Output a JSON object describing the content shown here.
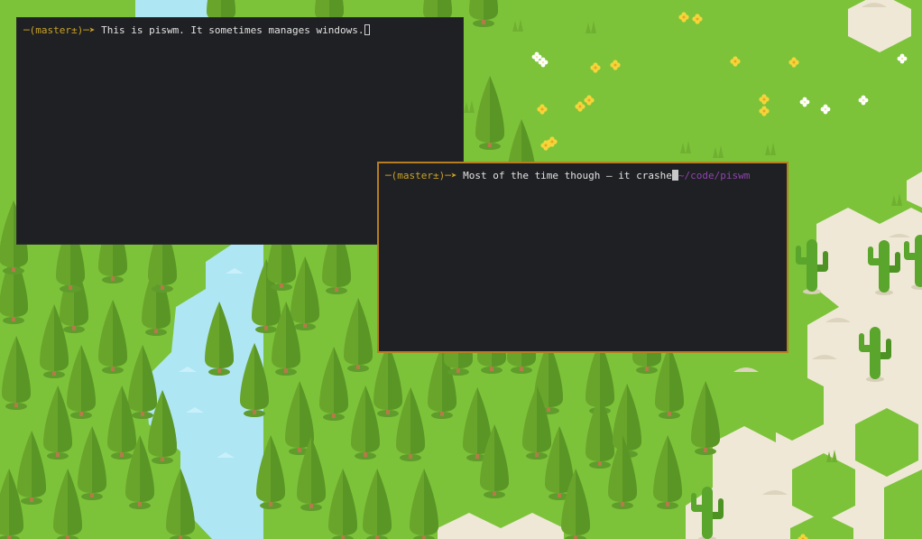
{
  "terminals": [
    {
      "prompt": "─(master±)─➤ ",
      "command": "This is piswm. It sometimes manages windows.",
      "focused": false
    },
    {
      "prompt": "─(master±)─➤ ",
      "command": "Most of the time though – it crashe",
      "right_prompt": "~/code/piswm",
      "focused": true,
      "border_color": "#b77d22"
    }
  ],
  "colors": {
    "grass": "#7cc33a",
    "sand": "#efe8d6",
    "water": "#aee6f4",
    "terminal_bg": "#1f2023",
    "prompt": "#c9a227",
    "path": "#8e44ad"
  }
}
